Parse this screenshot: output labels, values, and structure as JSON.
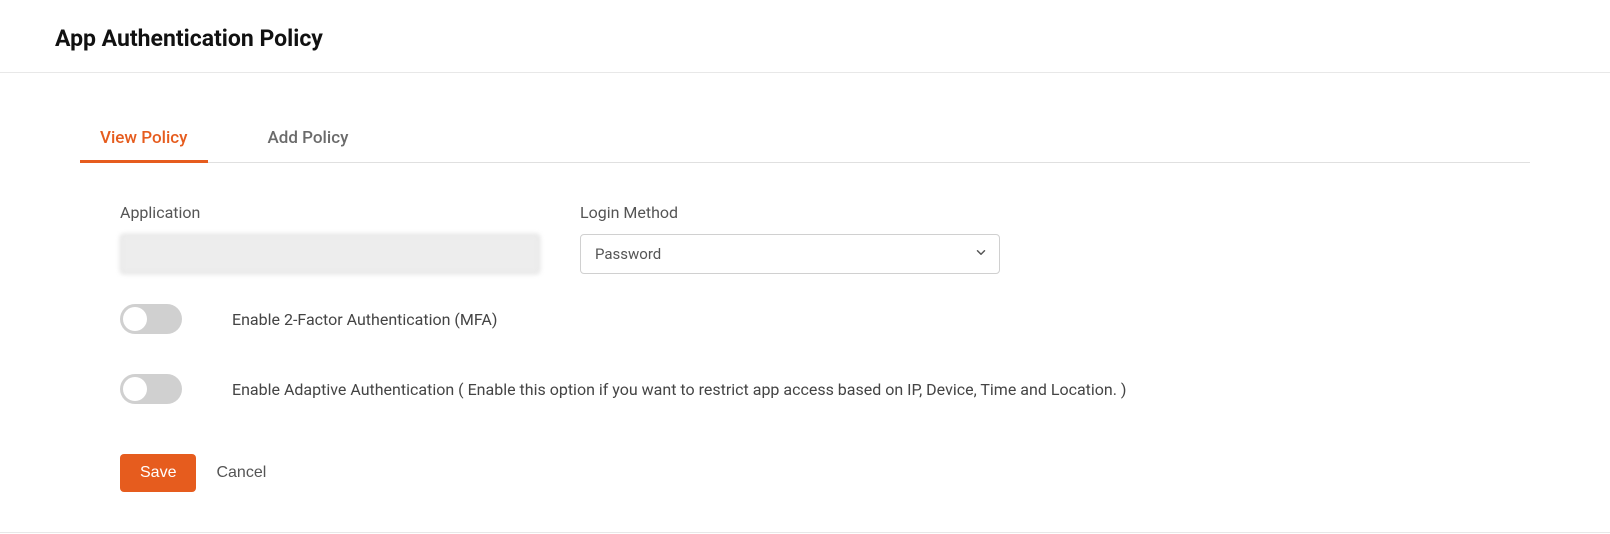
{
  "header": {
    "title": "App Authentication Policy"
  },
  "tabs": {
    "view": "View Policy",
    "add": "Add Policy"
  },
  "form": {
    "application_label": "Application",
    "application_value": "",
    "login_method_label": "Login Method",
    "login_method_value": "Password",
    "toggle_mfa_label": "Enable 2-Factor Authentication (MFA)",
    "toggle_mfa_checked": false,
    "toggle_adaptive_label": "Enable Adaptive Authentication ( Enable this option if you want to restrict app access based on IP, Device, Time and Location. )",
    "toggle_adaptive_checked": false
  },
  "buttons": {
    "save": "Save",
    "cancel": "Cancel"
  }
}
